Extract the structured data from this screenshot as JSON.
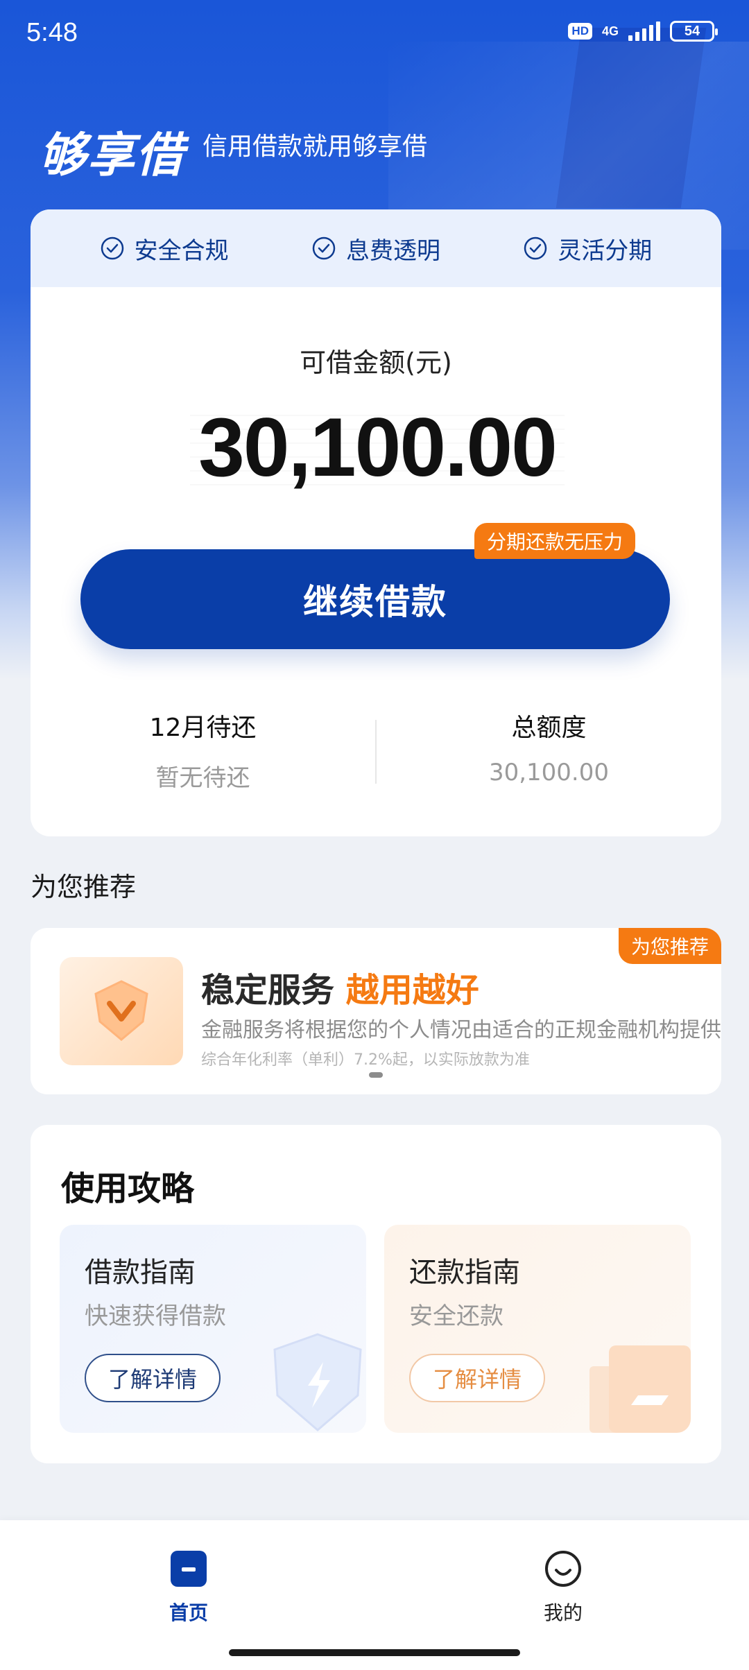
{
  "status_bar": {
    "time": "5:48",
    "hd": "HD",
    "network": "4G",
    "battery": "54"
  },
  "header": {
    "brand": "够享借",
    "slogan": "信用借款就用够享借"
  },
  "features": [
    "安全合规",
    "息费透明",
    "灵活分期"
  ],
  "loan": {
    "amount_label": "可借金额(元)",
    "amount": "30,100.00",
    "cta_tag": "分期还款无压力",
    "cta_label": "继续借款"
  },
  "stats": {
    "due_title": "12月待还",
    "due_value": "暂无待还",
    "total_title": "总额度",
    "total_value": "30,100.00"
  },
  "recommend": {
    "section_title": "为您推荐",
    "tag": "为您推荐",
    "title_prefix": "稳定服务",
    "title_highlight": "越用越好",
    "desc": "金融服务将根据您的个人情况由适合的正规金融机构提供",
    "note": "综合年化利率（单利）7.2%起，以实际放款为准"
  },
  "guide": {
    "title": "使用攻略",
    "items": [
      {
        "title": "借款指南",
        "subtitle": "快速获得借款",
        "button": "了解详情"
      },
      {
        "title": "还款指南",
        "subtitle": "安全还款",
        "button": "了解详情"
      }
    ]
  },
  "nav": {
    "home": "首页",
    "mine": "我的"
  },
  "colors": {
    "primary": "#0a3ea8",
    "accent": "#f57a12",
    "hero": "#1a56d8"
  }
}
